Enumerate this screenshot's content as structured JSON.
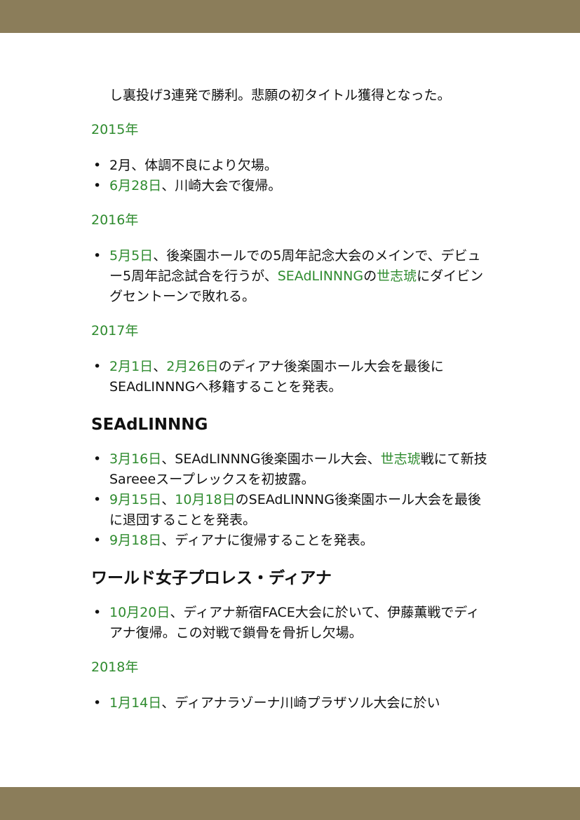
{
  "header_color": "#8b7d5a",
  "link_color": "#2e8b2e",
  "intro": {
    "line": "し裏投げ3連発で勝利。悲願の初タイトル獲得となった。"
  },
  "y2015": {
    "title": "2015年",
    "item1": "2月、体調不良により欠場。",
    "item2_link": "6月28日",
    "item2_text": "、川崎大会で復帰。"
  },
  "y2016": {
    "title": "2016年",
    "link1": "5月5日",
    "text1": "、後楽園ホールでの5周年記念大会のメインで、デビュー5周年記念試合を行うが、",
    "link2": "SEAdLINNNG",
    "text2": "の",
    "link3": "世志琥",
    "text3": "にダイビングセントーンで敗れる。"
  },
  "y2017": {
    "title": "2017年",
    "link1": "2月1日",
    "text1": "、",
    "link2": "2月26日",
    "text2": "のディアナ後楽園ホール大会を最後にSEAdLINNNGへ移籍することを発表。"
  },
  "seadlinnng": {
    "heading": "SEAdLINNNG",
    "i1_link1": "3月16日",
    "i1_text1": "、SEAdLINNNG後楽園ホール大会、",
    "i1_link2": "世志琥",
    "i1_text2": "戦にて新技Sareeeスープレックスを初披露。",
    "i2_link1": "9月15日",
    "i2_text1": "、",
    "i2_link2": "10月18日",
    "i2_text2": "のSEAdLINNNG後楽園ホール大会を最後に退団することを発表。",
    "i3_link": "9月18日",
    "i3_text": "、ディアナに復帰することを発表。"
  },
  "diana": {
    "heading": "ワールド女子プロレス・ディアナ",
    "i1_link": "10月20日",
    "i1_text": "、ディアナ新宿FACE大会に於いて、伊藤薫戦でディアナ復帰。この対戦で鎖骨を骨折し欠場。"
  },
  "y2018": {
    "title": "2018年",
    "i1_link": "1月14日",
    "i1_text": "、ディアナラゾーナ川崎プラザソル大会に於い"
  }
}
